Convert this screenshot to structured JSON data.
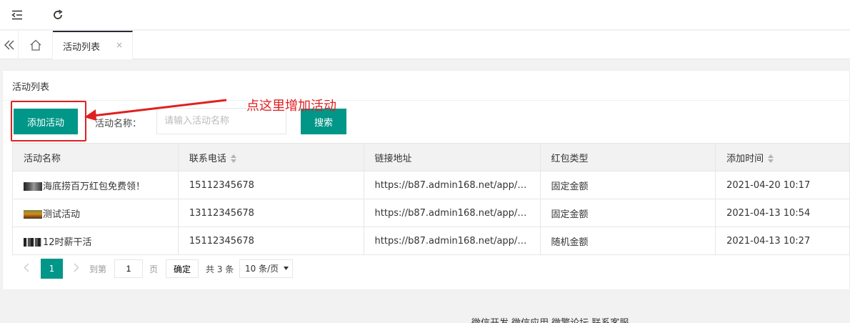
{
  "tabs": {
    "active_label": "活动列表",
    "close_glyph": "×"
  },
  "card": {
    "title": "活动列表"
  },
  "toolbar": {
    "add_label": "添加活动",
    "search_label": "活动名称：",
    "search_placeholder": "请输入活动名称",
    "search_value": "",
    "search_button": "搜索"
  },
  "annotation": {
    "text": "点这里增加活动",
    "color": "#e02020"
  },
  "table": {
    "columns": [
      "活动名称",
      "联系电话",
      "链接地址",
      "红包类型",
      "添加时间"
    ],
    "rows": [
      {
        "name": "海底捞百万红包免费领！",
        "phone": "15112345678",
        "link": "https://b87.admin168.net/app/in…",
        "type": "固定金额",
        "time": "2021-04-20 10:17"
      },
      {
        "name": "测试活动",
        "phone": "13112345678",
        "link": "https://b87.admin168.net/app/in…",
        "type": "固定金额",
        "time": "2021-04-13 10:54"
      },
      {
        "name": "12时薪干活",
        "phone": "15112345678",
        "link": "https://b87.admin168.net/app/in…",
        "type": "随机金额",
        "time": "2021-04-13 10:27"
      }
    ]
  },
  "pager": {
    "current_page": "1",
    "goto_label": "到第",
    "page_input": "1",
    "page_label": "页",
    "confirm_label": "确定",
    "total_label": "共 3 条",
    "page_size_label": "10 条/页"
  },
  "footer": {
    "text": "微信开发 微信应用 微擎论坛 联系客服"
  },
  "colors": {
    "primary": "#009688",
    "tab_top_border": "#292b34"
  }
}
